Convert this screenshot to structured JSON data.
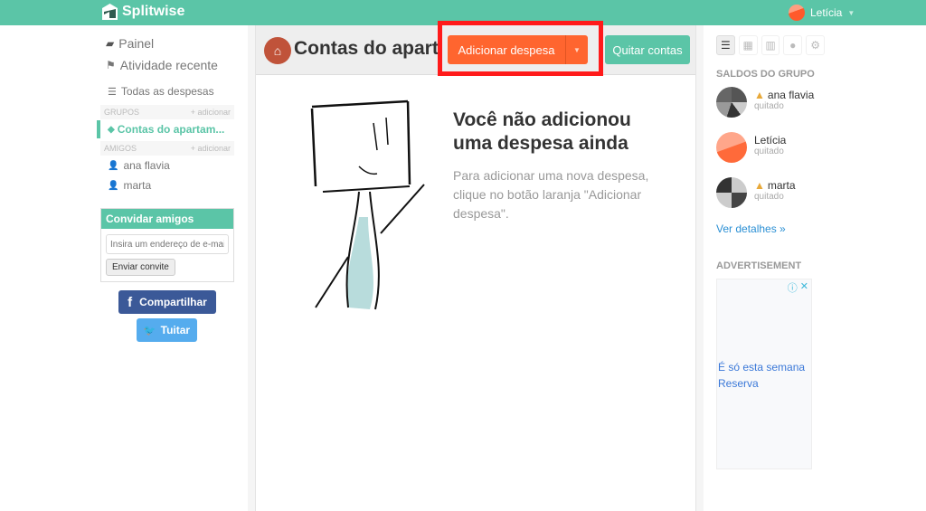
{
  "app": {
    "name": "Splitwise",
    "brand_color": "#5bc5a7",
    "accent_color": "#ff652f"
  },
  "user_menu": {
    "name": "Letícia"
  },
  "left_nav": {
    "items": [
      {
        "label": "Painel",
        "icon": "dashboard-icon"
      },
      {
        "label": "Atividade recente",
        "icon": "flag-icon"
      },
      {
        "label": "Todas as despesas",
        "icon": "list-icon"
      }
    ],
    "groups": {
      "header": "GRUPOS",
      "add_label": "+ adicionar",
      "items": [
        {
          "label": "Contas do apartam..."
        }
      ]
    },
    "friends": {
      "header": "AMIGOS",
      "add_label": "+ adicionar",
      "items": [
        {
          "label": "ana flavia"
        },
        {
          "label": "marta"
        }
      ]
    },
    "invite": {
      "title": "Convidar amigos",
      "placeholder": "Insira um endereço de e-mail",
      "button": "Enviar convite"
    },
    "share": {
      "facebook": "Compartilhar",
      "twitter": "Tuitar"
    }
  },
  "main": {
    "group_title": "Contas do apartamento",
    "add_expense_label": "Adicionar despesa",
    "settle_label": "Quitar contas",
    "empty_title": "Você não adicionou uma despesa ainda",
    "empty_text": "Para adicionar uma nova despesa, clique no botão laranja \"Adicionar despesa\"."
  },
  "right_panel": {
    "tabs": [
      "list-icon",
      "calendar-icon",
      "chart-icon",
      "chat-icon",
      "gear-icon"
    ],
    "balances_title": "SALDOS DO GRUPO",
    "balances": [
      {
        "name": "ana flavia",
        "status": "quitado",
        "warning": true
      },
      {
        "name": "Letícia",
        "status": "quitado",
        "warning": false
      },
      {
        "name": "marta",
        "status": "quitado",
        "warning": true
      }
    ],
    "details_link": "Ver detalhes »",
    "ad_label": "ADVERTISEMENT",
    "ad_text_1": "É só esta semana",
    "ad_text_2": "Reserva"
  }
}
